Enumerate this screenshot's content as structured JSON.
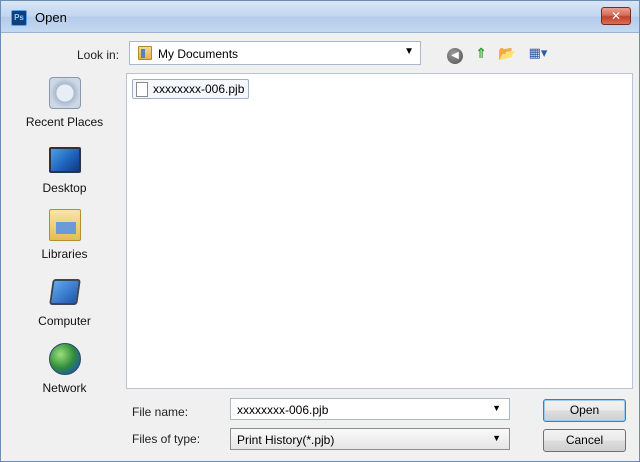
{
  "window": {
    "app_badge": "Ps",
    "title": "Open",
    "close_glyph": "✕"
  },
  "toolbar": {
    "lookin_label": "Look in:",
    "lookin_value": "My Documents",
    "icons": [
      "back-icon",
      "up-folder-icon",
      "new-folder-icon",
      "views-menu-icon"
    ]
  },
  "places": [
    {
      "label": "Recent Places",
      "icon": "recent-places-icon"
    },
    {
      "label": "Desktop",
      "icon": "desktop-icon"
    },
    {
      "label": "Libraries",
      "icon": "libraries-icon"
    },
    {
      "label": "Computer",
      "icon": "computer-icon"
    },
    {
      "label": "Network",
      "icon": "network-icon"
    }
  ],
  "files": [
    {
      "name": "xxxxxxxx-006.pjb",
      "selected": true
    }
  ],
  "form": {
    "filename_label": "File name:",
    "filename_value": "xxxxxxxx-006.pjb",
    "filetype_label": "Files of type:",
    "filetype_value": "Print History(*.pjb)"
  },
  "buttons": {
    "open": "Open",
    "cancel": "Cancel"
  },
  "colors": {
    "title_bar": "#c2d6ef",
    "close_button": "#c1412a",
    "selection_border": "#9fb1c8"
  }
}
